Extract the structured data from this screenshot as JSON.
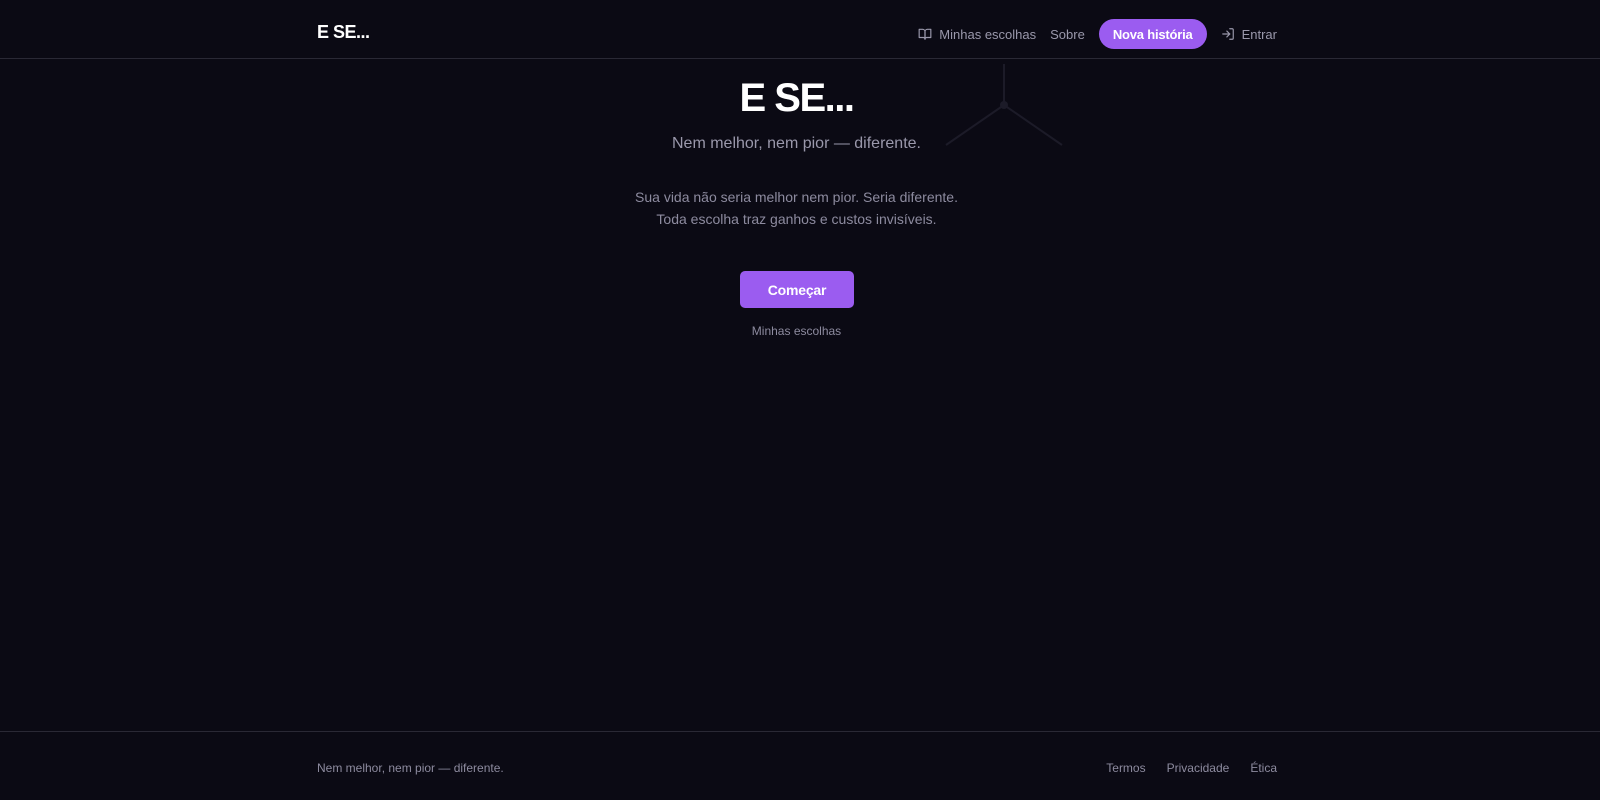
{
  "header": {
    "brand": "E SE...",
    "nav": {
      "my_choices_label": "Minhas escolhas",
      "my_choices_icon": "book-open-icon",
      "about_label": "Sobre",
      "new_story_label": "Nova história",
      "login_label": "Entrar",
      "login_icon": "log-in-icon"
    }
  },
  "hero": {
    "title": "E SE...",
    "subtitle": "Nem melhor, nem pior — diferente.",
    "description_line1": "Sua vida não seria melhor nem pior. Seria diferente.",
    "description_line2": "Toda escolha traz ganhos e custos invisíveis.",
    "start_button": "Começar",
    "secondary_link": "Minhas escolhas"
  },
  "footer": {
    "tagline": "Nem melhor, nem pior — diferente.",
    "links": [
      "Termos",
      "Privacidade",
      "Ética"
    ]
  },
  "colors": {
    "background": "#0b0a14",
    "accent": "#9b5cf0",
    "text_muted": "#9a98ab",
    "border": "#2a2935"
  }
}
